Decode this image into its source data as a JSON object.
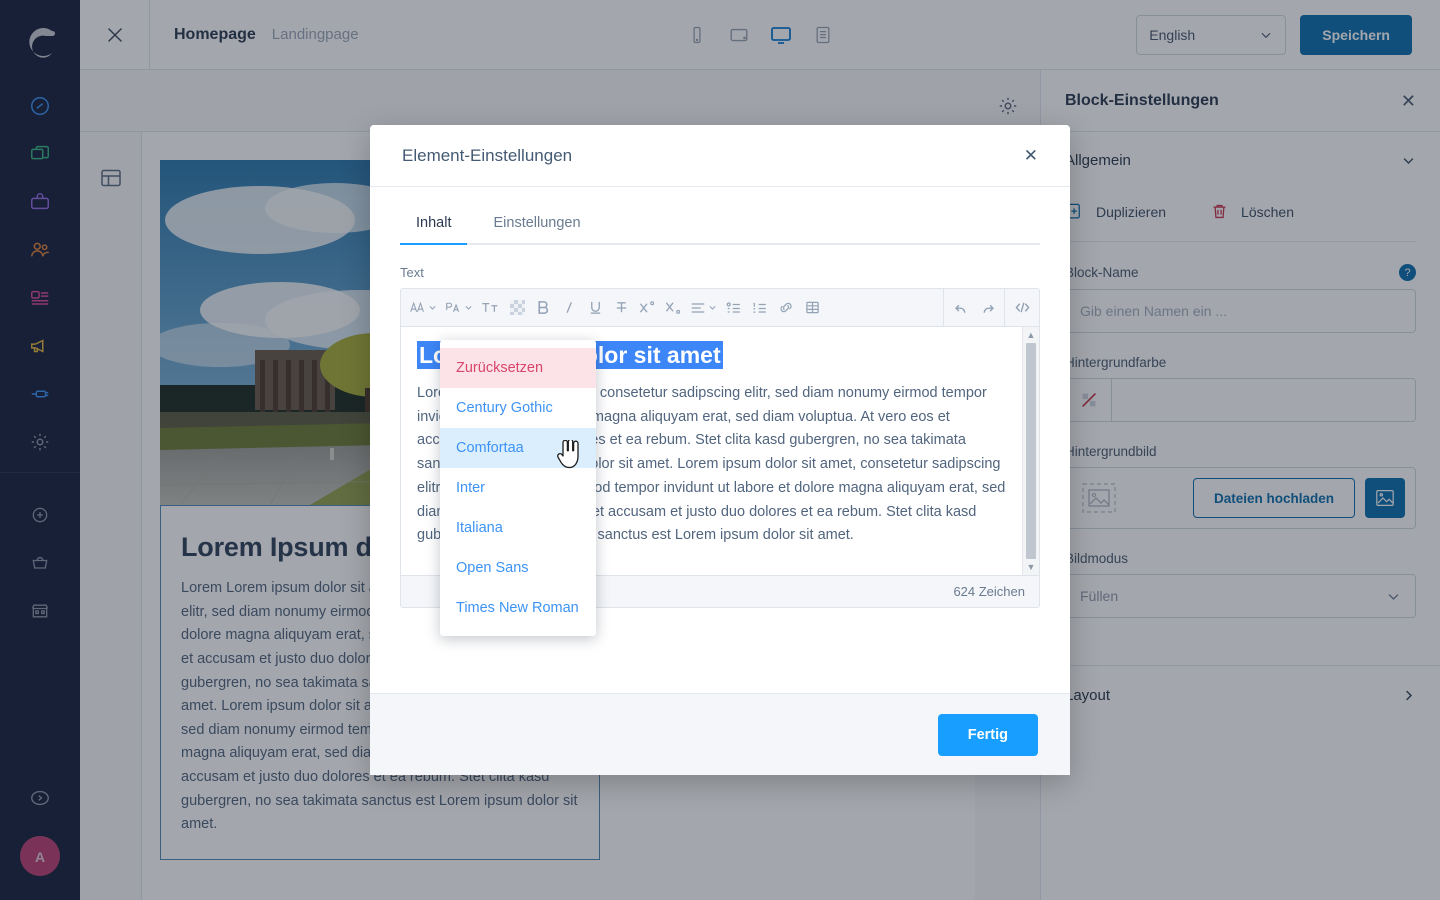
{
  "app": {
    "brand": "shopware-logo",
    "avatar_initial": "A"
  },
  "rail": {
    "items": [
      {
        "name": "dashboard",
        "icon": "gauge-icon",
        "color": "#3d93f5"
      },
      {
        "name": "catalogues",
        "icon": "copy-icon",
        "color": "#37b682"
      },
      {
        "name": "orders",
        "icon": "bag-icon",
        "color": "#9a6ae8"
      },
      {
        "name": "customers",
        "icon": "users-icon",
        "color": "#e8823a"
      },
      {
        "name": "content",
        "icon": "content-icon",
        "color": "#e0499b"
      },
      {
        "name": "marketing",
        "icon": "megaphone-icon",
        "color": "#e8b93a"
      },
      {
        "name": "extensions",
        "icon": "plug-icon",
        "color": "#3d93f5"
      },
      {
        "name": "settings",
        "icon": "gear-icon",
        "color": "#8d99a8"
      }
    ],
    "secondary": [
      {
        "name": "add",
        "icon": "plus-circle-icon",
        "color": "#8d99a8"
      },
      {
        "name": "shop",
        "icon": "basket-icon",
        "color": "#8d99a8"
      },
      {
        "name": "storefront",
        "icon": "store-icon",
        "color": "#8d99a8"
      }
    ],
    "collapse_icon": "chevron-right-circle-icon"
  },
  "topbar": {
    "close_icon": "close-icon",
    "title": "Homepage",
    "subtitle": "Landingpage",
    "devices": [
      {
        "name": "mobile",
        "icon": "mobile-icon",
        "active": false
      },
      {
        "name": "tablet",
        "icon": "tablet-icon",
        "active": false
      },
      {
        "name": "desktop",
        "icon": "desktop-icon",
        "active": true
      },
      {
        "name": "fullwidth",
        "icon": "list-icon",
        "active": false
      }
    ],
    "language": "English",
    "save_label": "Speichern"
  },
  "stage": {
    "section_icon": "layout-icon",
    "settings_icon": "gear-icon",
    "add_label": "+",
    "block": {
      "heading": "Lorem Ipsum dolor sit amet",
      "paragraph": "Lorem Lorem ipsum dolor sit amet, consetetur sadipscing elitr, sed diam nonumy eirmod tempor invidunt ut labore et dolore magna aliquyam erat, sed diam voluptua. At vero eos et accusam et justo duo dolores et ea rebum. Stet clita kasd gubergren, no sea takimata sanctus est Lorem ipsum dolor sit amet. Lorem ipsum dolor sit amet, consetetur sadipscing elitr, sed diam nonumy eirmod tempor invidunt ut labore et dolore magna aliquyam erat, sed diam voluptua. At vero eos et accusam et justo duo dolores et ea rebum. Stet clita kasd gubergren, no sea takimata sanctus est Lorem ipsum dolor sit amet."
    }
  },
  "right_panel": {
    "title": "Block-Einstellungen",
    "close_icon": "close-icon",
    "section_general": "Allgemein",
    "duplicate_label": "Duplizieren",
    "delete_label": "Löschen",
    "block_name_label": "Block-Name",
    "block_name_placeholder": "Gib einen Namen ein ...",
    "bg_color_label": "Hintergrundfarbe",
    "bg_image_label": "Hintergrundbild",
    "upload_label": "Dateien hochladen",
    "image_mode_label": "Bildmodus",
    "image_mode_value": "Füllen",
    "layout_label": "Layout"
  },
  "modal": {
    "title": "Element-Einstellungen",
    "close_icon": "close-icon",
    "tabs": [
      {
        "label": "Inhalt",
        "active": true
      },
      {
        "label": "Einstellungen",
        "active": false
      }
    ],
    "field_label": "Text",
    "toolbar": [
      {
        "name": "font-family",
        "icon": "font-family-icon",
        "has_chevron": true
      },
      {
        "name": "font-size",
        "icon": "font-size-icon",
        "has_chevron": true
      },
      {
        "name": "clear-format",
        "icon": "text-format-icon",
        "has_chevron": false
      },
      {
        "name": "text-color",
        "icon": "color-swatch-icon",
        "has_chevron": false
      },
      {
        "name": "bold",
        "icon": "bold-icon",
        "has_chevron": false
      },
      {
        "name": "italic",
        "icon": "italic-icon",
        "has_chevron": false
      },
      {
        "name": "underline",
        "icon": "underline-icon",
        "has_chevron": false
      },
      {
        "name": "strikethrough",
        "icon": "strikethrough-icon",
        "has_chevron": false
      },
      {
        "name": "superscript",
        "icon": "superscript-icon",
        "has_chevron": false
      },
      {
        "name": "subscript",
        "icon": "subscript-icon",
        "has_chevron": false
      },
      {
        "name": "align",
        "icon": "align-icon",
        "has_chevron": true
      },
      {
        "name": "bullet-list",
        "icon": "bullet-list-icon",
        "has_chevron": false
      },
      {
        "name": "numbered-list",
        "icon": "numbered-list-icon",
        "has_chevron": false
      },
      {
        "name": "link",
        "icon": "link-icon",
        "has_chevron": false
      },
      {
        "name": "table",
        "icon": "table-icon",
        "has_chevron": false
      },
      {
        "name": "undo",
        "icon": "undo-icon",
        "has_chevron": false
      },
      {
        "name": "redo",
        "icon": "redo-icon",
        "has_chevron": false
      },
      {
        "name": "source-code",
        "icon": "code-icon",
        "has_chevron": false
      }
    ],
    "editor": {
      "heading": "Lorem ipsum dolor sit amet",
      "heading_selected": true,
      "paragraph": "Lorem ipsum dolor sit amet, consetetur sadipscing elitr, sed diam nonumy eirmod tempor invidunt ut labore et dolore magna aliquyam erat, sed diam voluptua. At vero eos et accusam et justo duo dolores et ea rebum. Stet clita kasd gubergren, no sea takimata sanctus est Lorem ipsum dolor sit amet. Lorem ipsum dolor sit amet, consetetur sadipscing elitr, sed diam nonumy eirmod tempor invidunt ut labore et dolore magna aliquyam erat, sed diam voluptua. At vero eos et accusam et justo duo dolores et ea rebum. Stet clita kasd gubergren, no sea takimata sanctus est Lorem ipsum dolor sit amet.",
      "char_count": "624 Zeichen"
    },
    "done_label": "Fertig"
  },
  "font_menu": {
    "items": [
      {
        "label": "Zurücksetzen",
        "kind": "reset"
      },
      {
        "label": "Century Gothic",
        "kind": "font"
      },
      {
        "label": "Comfortaa",
        "kind": "font",
        "hovered": true
      },
      {
        "label": "Inter",
        "kind": "font"
      },
      {
        "label": "Italiana",
        "kind": "font"
      },
      {
        "label": "Open Sans",
        "kind": "font"
      },
      {
        "label": "Times New Roman",
        "kind": "font"
      }
    ]
  },
  "colors": {
    "rail_bg": "#16213c",
    "primary": "#0b6ead",
    "accent": "#189eff",
    "selection": "#3d86f7",
    "danger": "#d9456b",
    "avatar": "#bd3f75"
  }
}
